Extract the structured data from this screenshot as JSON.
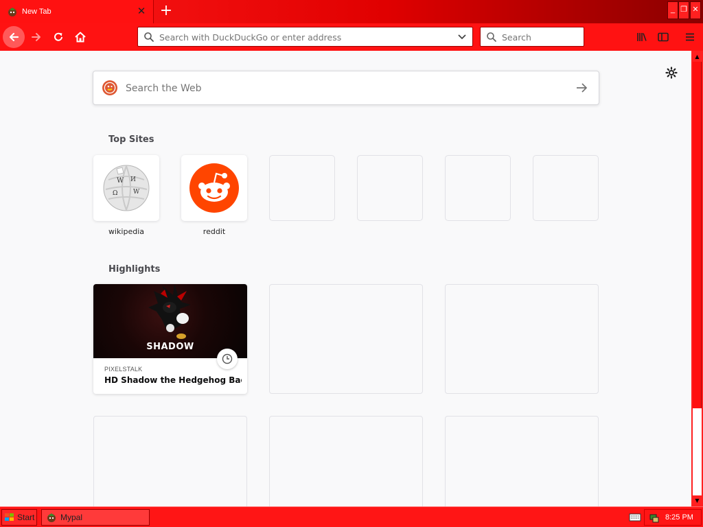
{
  "window": {
    "tab_title": "New Tab",
    "minimize": "_",
    "restore": "❐",
    "close": "✕"
  },
  "toolbar": {
    "url_placeholder": "Search with DuckDuckGo or enter address",
    "search_placeholder": "Search"
  },
  "newtab": {
    "web_search_placeholder": "Search the Web",
    "top_sites_title": "Top Sites",
    "top_sites": [
      {
        "label": "wikipedia",
        "icon": "wikipedia-icon"
      },
      {
        "label": "reddit",
        "icon": "reddit-icon"
      }
    ],
    "highlights_title": "Highlights",
    "highlights": [
      {
        "source": "PIXELSTALK",
        "title": "HD Shadow the Hedgehog Back...",
        "thumb_text": "SHADOW"
      }
    ]
  },
  "taskbar": {
    "start_label": "Start",
    "task_label": "Mypal",
    "clock": "8:25 PM"
  },
  "colors": {
    "chrome_red": "#ff1212",
    "reddit_orange": "#ff4500"
  }
}
